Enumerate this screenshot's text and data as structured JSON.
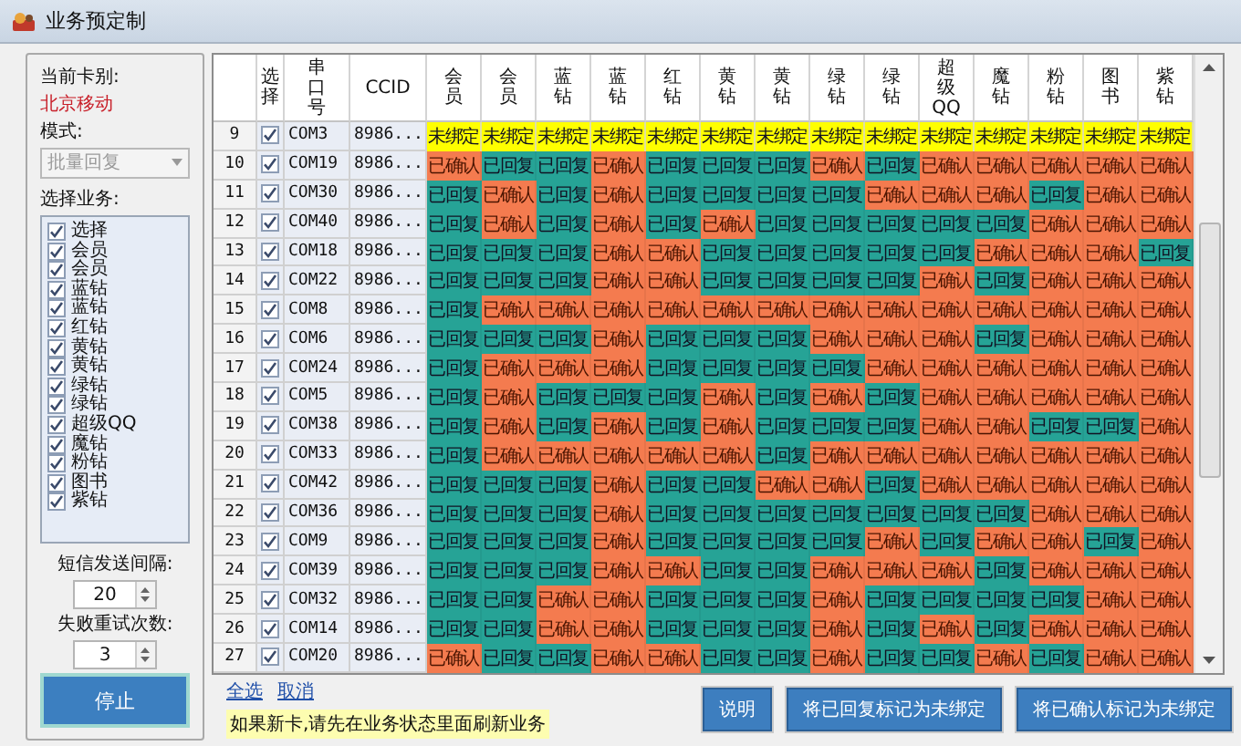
{
  "window": {
    "title": "业务预定制"
  },
  "sidebar": {
    "card_type_label": "当前卡别:",
    "card_type": "北京移动",
    "mode_label": "模式:",
    "mode": {
      "value": "批量回复",
      "disabled": true
    },
    "services_label": "选择业务:",
    "services": [
      {
        "label": "选择",
        "checked": true
      },
      {
        "label": "会员",
        "checked": true
      },
      {
        "label": "会员",
        "checked": true
      },
      {
        "label": "蓝钻",
        "checked": true
      },
      {
        "label": "蓝钻",
        "checked": true
      },
      {
        "label": "红钻",
        "checked": true
      },
      {
        "label": "黄钻",
        "checked": true
      },
      {
        "label": "黄钻",
        "checked": true
      },
      {
        "label": "绿钻",
        "checked": true
      },
      {
        "label": "绿钻",
        "checked": true
      },
      {
        "label": "超级QQ",
        "checked": true
      },
      {
        "label": "魔钻",
        "checked": true
      },
      {
        "label": "粉钻",
        "checked": true
      },
      {
        "label": "图书",
        "checked": true
      },
      {
        "label": "紫钻",
        "checked": true
      }
    ],
    "interval_label": "短信发送间隔:",
    "interval": "20",
    "retries_label": "失败重试次数:",
    "retries": "3",
    "stop_button": "停止"
  },
  "table": {
    "fixed_columns": [
      {
        "label": "选择",
        "kind": "vertical"
      },
      {
        "label": "串口号",
        "kind": "vertical"
      },
      {
        "label": "CCID",
        "kind": "horizontal"
      }
    ],
    "service_columns": [
      {
        "label": "会员",
        "kind": "vertical"
      },
      {
        "label": "会员",
        "kind": "vertical"
      },
      {
        "label": "蓝钻",
        "kind": "vertical"
      },
      {
        "label": "蓝钻",
        "kind": "vertical"
      },
      {
        "label": "红钻",
        "kind": "vertical"
      },
      {
        "label": "黄钻",
        "kind": "vertical"
      },
      {
        "label": "黄钻",
        "kind": "vertical"
      },
      {
        "label": "绿钻",
        "kind": "vertical"
      },
      {
        "label": "绿钻",
        "kind": "vertical"
      },
      {
        "label": "超级QQ",
        "kind": "vertical"
      },
      {
        "label": "魔钻",
        "kind": "vertical"
      },
      {
        "label": "粉钻",
        "kind": "vertical"
      },
      {
        "label": "图书",
        "kind": "vertical"
      },
      {
        "label": "紫钻",
        "kind": "vertical"
      }
    ],
    "rows": [
      {
        "number": "9",
        "checked": true,
        "port": "COM3",
        "ccid": "8986...",
        "cells": [
          {
            "text": "未绑定",
            "kind": "unbound"
          },
          {
            "text": "未绑定",
            "kind": "unbound"
          },
          {
            "text": "未绑定",
            "kind": "unbound"
          },
          {
            "text": "未绑定",
            "kind": "unbound"
          },
          {
            "text": "未绑定",
            "kind": "unbound"
          },
          {
            "text": "未绑定",
            "kind": "unbound"
          },
          {
            "text": "未绑定",
            "kind": "unbound"
          },
          {
            "text": "未绑定",
            "kind": "unbound"
          },
          {
            "text": "未绑定",
            "kind": "unbound"
          },
          {
            "text": "未绑定",
            "kind": "unbound"
          },
          {
            "text": "未绑定",
            "kind": "unbound"
          },
          {
            "text": "未绑定",
            "kind": "unbound"
          },
          {
            "text": "未绑定",
            "kind": "unbound"
          },
          {
            "text": "未绑定",
            "kind": "unbound"
          }
        ]
      },
      {
        "number": "10",
        "checked": true,
        "port": "COM19",
        "ccid": "8986...",
        "cells": [
          {
            "text": "已确认",
            "kind": "confirmed"
          },
          {
            "text": "已回复",
            "kind": "replied"
          },
          {
            "text": "已回复",
            "kind": "replied"
          },
          {
            "text": "已确认",
            "kind": "confirmed"
          },
          {
            "text": "已回复",
            "kind": "replied"
          },
          {
            "text": "已回复",
            "kind": "replied"
          },
          {
            "text": "已回复",
            "kind": "replied"
          },
          {
            "text": "已确认",
            "kind": "confirmed"
          },
          {
            "text": "已回复",
            "kind": "replied"
          },
          {
            "text": "已确认",
            "kind": "confirmed"
          },
          {
            "text": "已确认",
            "kind": "confirmed"
          },
          {
            "text": "已确认",
            "kind": "confirmed"
          },
          {
            "text": "已确认",
            "kind": "confirmed"
          },
          {
            "text": "已确认",
            "kind": "confirmed"
          }
        ]
      },
      {
        "number": "11",
        "checked": true,
        "port": "COM30",
        "ccid": "8986...",
        "cells": [
          {
            "text": "已回复",
            "kind": "replied"
          },
          {
            "text": "已确认",
            "kind": "confirmed"
          },
          {
            "text": "已回复",
            "kind": "replied"
          },
          {
            "text": "已确认",
            "kind": "confirmed"
          },
          {
            "text": "已回复",
            "kind": "replied"
          },
          {
            "text": "已回复",
            "kind": "replied"
          },
          {
            "text": "已回复",
            "kind": "replied"
          },
          {
            "text": "已回复",
            "kind": "replied"
          },
          {
            "text": "已确认",
            "kind": "confirmed"
          },
          {
            "text": "已确认",
            "kind": "confirmed"
          },
          {
            "text": "已确认",
            "kind": "confirmed"
          },
          {
            "text": "已回复",
            "kind": "replied"
          },
          {
            "text": "已确认",
            "kind": "confirmed"
          },
          {
            "text": "已确认",
            "kind": "confirmed"
          }
        ]
      },
      {
        "number": "12",
        "checked": true,
        "port": "COM40",
        "ccid": "8986...",
        "cells": [
          {
            "text": "已回复",
            "kind": "replied"
          },
          {
            "text": "已确认",
            "kind": "confirmed"
          },
          {
            "text": "已回复",
            "kind": "replied"
          },
          {
            "text": "已确认",
            "kind": "confirmed"
          },
          {
            "text": "已回复",
            "kind": "replied"
          },
          {
            "text": "已确认",
            "kind": "confirmed"
          },
          {
            "text": "已回复",
            "kind": "replied"
          },
          {
            "text": "已回复",
            "kind": "replied"
          },
          {
            "text": "已回复",
            "kind": "replied"
          },
          {
            "text": "已回复",
            "kind": "replied"
          },
          {
            "text": "已回复",
            "kind": "replied"
          },
          {
            "text": "已确认",
            "kind": "confirmed"
          },
          {
            "text": "已确认",
            "kind": "confirmed"
          },
          {
            "text": "已确认",
            "kind": "confirmed"
          }
        ]
      },
      {
        "number": "13",
        "checked": true,
        "port": "COM18",
        "ccid": "8986...",
        "cells": [
          {
            "text": "已回复",
            "kind": "replied"
          },
          {
            "text": "已回复",
            "kind": "replied"
          },
          {
            "text": "已回复",
            "kind": "replied"
          },
          {
            "text": "已确认",
            "kind": "confirmed"
          },
          {
            "text": "已确认",
            "kind": "confirmed"
          },
          {
            "text": "已回复",
            "kind": "replied"
          },
          {
            "text": "已回复",
            "kind": "replied"
          },
          {
            "text": "已回复",
            "kind": "replied"
          },
          {
            "text": "已回复",
            "kind": "replied"
          },
          {
            "text": "已回复",
            "kind": "replied"
          },
          {
            "text": "已确认",
            "kind": "confirmed"
          },
          {
            "text": "已确认",
            "kind": "confirmed"
          },
          {
            "text": "已确认",
            "kind": "confirmed"
          },
          {
            "text": "已回复",
            "kind": "replied"
          }
        ]
      },
      {
        "number": "14",
        "checked": true,
        "port": "COM22",
        "ccid": "8986...",
        "cells": [
          {
            "text": "已回复",
            "kind": "replied"
          },
          {
            "text": "已回复",
            "kind": "replied"
          },
          {
            "text": "已回复",
            "kind": "replied"
          },
          {
            "text": "已确认",
            "kind": "confirmed"
          },
          {
            "text": "已确认",
            "kind": "confirmed"
          },
          {
            "text": "已回复",
            "kind": "replied"
          },
          {
            "text": "已回复",
            "kind": "replied"
          },
          {
            "text": "已回复",
            "kind": "replied"
          },
          {
            "text": "已回复",
            "kind": "replied"
          },
          {
            "text": "已确认",
            "kind": "confirmed"
          },
          {
            "text": "已回复",
            "kind": "replied"
          },
          {
            "text": "已确认",
            "kind": "confirmed"
          },
          {
            "text": "已确认",
            "kind": "confirmed"
          },
          {
            "text": "已确认",
            "kind": "confirmed"
          }
        ]
      },
      {
        "number": "15",
        "checked": true,
        "port": "COM8",
        "ccid": "8986...",
        "cells": [
          {
            "text": "已回复",
            "kind": "replied"
          },
          {
            "text": "已确认",
            "kind": "confirmed"
          },
          {
            "text": "已确认",
            "kind": "confirmed"
          },
          {
            "text": "已确认",
            "kind": "confirmed"
          },
          {
            "text": "已确认",
            "kind": "confirmed"
          },
          {
            "text": "已确认",
            "kind": "confirmed"
          },
          {
            "text": "已确认",
            "kind": "confirmed"
          },
          {
            "text": "已确认",
            "kind": "confirmed"
          },
          {
            "text": "已确认",
            "kind": "confirmed"
          },
          {
            "text": "已确认",
            "kind": "confirmed"
          },
          {
            "text": "已确认",
            "kind": "confirmed"
          },
          {
            "text": "已确认",
            "kind": "confirmed"
          },
          {
            "text": "已确认",
            "kind": "confirmed"
          },
          {
            "text": "已确认",
            "kind": "confirmed"
          }
        ]
      },
      {
        "number": "16",
        "checked": true,
        "port": "COM6",
        "ccid": "8986...",
        "cells": [
          {
            "text": "已回复",
            "kind": "replied"
          },
          {
            "text": "已回复",
            "kind": "replied"
          },
          {
            "text": "已回复",
            "kind": "replied"
          },
          {
            "text": "已确认",
            "kind": "confirmed"
          },
          {
            "text": "已回复",
            "kind": "replied"
          },
          {
            "text": "已回复",
            "kind": "replied"
          },
          {
            "text": "已回复",
            "kind": "replied"
          },
          {
            "text": "已确认",
            "kind": "confirmed"
          },
          {
            "text": "已确认",
            "kind": "confirmed"
          },
          {
            "text": "已确认",
            "kind": "confirmed"
          },
          {
            "text": "已回复",
            "kind": "replied"
          },
          {
            "text": "已确认",
            "kind": "confirmed"
          },
          {
            "text": "已确认",
            "kind": "confirmed"
          },
          {
            "text": "已确认",
            "kind": "confirmed"
          }
        ]
      },
      {
        "number": "17",
        "checked": true,
        "port": "COM24",
        "ccid": "8986...",
        "cells": [
          {
            "text": "已回复",
            "kind": "replied"
          },
          {
            "text": "已确认",
            "kind": "confirmed"
          },
          {
            "text": "已确认",
            "kind": "confirmed"
          },
          {
            "text": "已确认",
            "kind": "confirmed"
          },
          {
            "text": "已回复",
            "kind": "replied"
          },
          {
            "text": "已回复",
            "kind": "replied"
          },
          {
            "text": "已回复",
            "kind": "replied"
          },
          {
            "text": "已回复",
            "kind": "replied"
          },
          {
            "text": "已确认",
            "kind": "confirmed"
          },
          {
            "text": "已确认",
            "kind": "confirmed"
          },
          {
            "text": "已确认",
            "kind": "confirmed"
          },
          {
            "text": "已确认",
            "kind": "confirmed"
          },
          {
            "text": "已确认",
            "kind": "confirmed"
          },
          {
            "text": "已确认",
            "kind": "confirmed"
          }
        ]
      },
      {
        "number": "18",
        "checked": true,
        "port": "COM5",
        "ccid": "8986...",
        "cells": [
          {
            "text": "已回复",
            "kind": "replied"
          },
          {
            "text": "已确认",
            "kind": "confirmed"
          },
          {
            "text": "已回复",
            "kind": "replied"
          },
          {
            "text": "已回复",
            "kind": "replied"
          },
          {
            "text": "已回复",
            "kind": "replied"
          },
          {
            "text": "已确认",
            "kind": "confirmed"
          },
          {
            "text": "已回复",
            "kind": "replied"
          },
          {
            "text": "已确认",
            "kind": "confirmed"
          },
          {
            "text": "已回复",
            "kind": "replied"
          },
          {
            "text": "已确认",
            "kind": "confirmed"
          },
          {
            "text": "已确认",
            "kind": "confirmed"
          },
          {
            "text": "已确认",
            "kind": "confirmed"
          },
          {
            "text": "已确认",
            "kind": "confirmed"
          },
          {
            "text": "已确认",
            "kind": "confirmed"
          }
        ]
      },
      {
        "number": "19",
        "checked": true,
        "port": "COM38",
        "ccid": "8986...",
        "cells": [
          {
            "text": "已回复",
            "kind": "replied"
          },
          {
            "text": "已确认",
            "kind": "confirmed"
          },
          {
            "text": "已回复",
            "kind": "replied"
          },
          {
            "text": "已确认",
            "kind": "confirmed"
          },
          {
            "text": "已回复",
            "kind": "replied"
          },
          {
            "text": "已确认",
            "kind": "confirmed"
          },
          {
            "text": "已回复",
            "kind": "replied"
          },
          {
            "text": "已回复",
            "kind": "replied"
          },
          {
            "text": "已回复",
            "kind": "replied"
          },
          {
            "text": "已确认",
            "kind": "confirmed"
          },
          {
            "text": "已确认",
            "kind": "confirmed"
          },
          {
            "text": "已回复",
            "kind": "replied"
          },
          {
            "text": "已回复",
            "kind": "replied"
          },
          {
            "text": "已确认",
            "kind": "confirmed"
          }
        ]
      },
      {
        "number": "20",
        "checked": true,
        "port": "COM33",
        "ccid": "8986...",
        "cells": [
          {
            "text": "已回复",
            "kind": "replied"
          },
          {
            "text": "已确认",
            "kind": "confirmed"
          },
          {
            "text": "已确认",
            "kind": "confirmed"
          },
          {
            "text": "已确认",
            "kind": "confirmed"
          },
          {
            "text": "已确认",
            "kind": "confirmed"
          },
          {
            "text": "已确认",
            "kind": "confirmed"
          },
          {
            "text": "已回复",
            "kind": "replied"
          },
          {
            "text": "已确认",
            "kind": "confirmed"
          },
          {
            "text": "已确认",
            "kind": "confirmed"
          },
          {
            "text": "已确认",
            "kind": "confirmed"
          },
          {
            "text": "已确认",
            "kind": "confirmed"
          },
          {
            "text": "已确认",
            "kind": "confirmed"
          },
          {
            "text": "已确认",
            "kind": "confirmed"
          },
          {
            "text": "已确认",
            "kind": "confirmed"
          }
        ]
      },
      {
        "number": "21",
        "checked": true,
        "port": "COM42",
        "ccid": "8986...",
        "cells": [
          {
            "text": "已回复",
            "kind": "replied"
          },
          {
            "text": "已回复",
            "kind": "replied"
          },
          {
            "text": "已回复",
            "kind": "replied"
          },
          {
            "text": "已确认",
            "kind": "confirmed"
          },
          {
            "text": "已回复",
            "kind": "replied"
          },
          {
            "text": "已回复",
            "kind": "replied"
          },
          {
            "text": "已确认",
            "kind": "confirmed"
          },
          {
            "text": "已确认",
            "kind": "confirmed"
          },
          {
            "text": "已回复",
            "kind": "replied"
          },
          {
            "text": "已确认",
            "kind": "confirmed"
          },
          {
            "text": "已确认",
            "kind": "confirmed"
          },
          {
            "text": "已确认",
            "kind": "confirmed"
          },
          {
            "text": "已确认",
            "kind": "confirmed"
          },
          {
            "text": "已确认",
            "kind": "confirmed"
          }
        ]
      },
      {
        "number": "22",
        "checked": true,
        "port": "COM36",
        "ccid": "8986...",
        "cells": [
          {
            "text": "已回复",
            "kind": "replied"
          },
          {
            "text": "已回复",
            "kind": "replied"
          },
          {
            "text": "已回复",
            "kind": "replied"
          },
          {
            "text": "已确认",
            "kind": "confirmed"
          },
          {
            "text": "已回复",
            "kind": "replied"
          },
          {
            "text": "已回复",
            "kind": "replied"
          },
          {
            "text": "已回复",
            "kind": "replied"
          },
          {
            "text": "已回复",
            "kind": "replied"
          },
          {
            "text": "已回复",
            "kind": "replied"
          },
          {
            "text": "已回复",
            "kind": "replied"
          },
          {
            "text": "已回复",
            "kind": "replied"
          },
          {
            "text": "已确认",
            "kind": "confirmed"
          },
          {
            "text": "已确认",
            "kind": "confirmed"
          },
          {
            "text": "已确认",
            "kind": "confirmed"
          }
        ]
      },
      {
        "number": "23",
        "checked": true,
        "port": "COM9",
        "ccid": "8986...",
        "cells": [
          {
            "text": "已回复",
            "kind": "replied"
          },
          {
            "text": "已回复",
            "kind": "replied"
          },
          {
            "text": "已回复",
            "kind": "replied"
          },
          {
            "text": "已确认",
            "kind": "confirmed"
          },
          {
            "text": "已回复",
            "kind": "replied"
          },
          {
            "text": "已回复",
            "kind": "replied"
          },
          {
            "text": "已回复",
            "kind": "replied"
          },
          {
            "text": "已回复",
            "kind": "replied"
          },
          {
            "text": "已确认",
            "kind": "confirmed"
          },
          {
            "text": "已回复",
            "kind": "replied"
          },
          {
            "text": "已确认",
            "kind": "confirmed"
          },
          {
            "text": "已确认",
            "kind": "confirmed"
          },
          {
            "text": "已回复",
            "kind": "replied"
          },
          {
            "text": "已确认",
            "kind": "confirmed"
          }
        ]
      },
      {
        "number": "24",
        "checked": true,
        "port": "COM39",
        "ccid": "8986...",
        "cells": [
          {
            "text": "已回复",
            "kind": "replied"
          },
          {
            "text": "已回复",
            "kind": "replied"
          },
          {
            "text": "已回复",
            "kind": "replied"
          },
          {
            "text": "已确认",
            "kind": "confirmed"
          },
          {
            "text": "已确认",
            "kind": "confirmed"
          },
          {
            "text": "已回复",
            "kind": "replied"
          },
          {
            "text": "已回复",
            "kind": "replied"
          },
          {
            "text": "已确认",
            "kind": "confirmed"
          },
          {
            "text": "已确认",
            "kind": "confirmed"
          },
          {
            "text": "已确认",
            "kind": "confirmed"
          },
          {
            "text": "已回复",
            "kind": "replied"
          },
          {
            "text": "已确认",
            "kind": "confirmed"
          },
          {
            "text": "已确认",
            "kind": "confirmed"
          },
          {
            "text": "已确认",
            "kind": "confirmed"
          }
        ]
      },
      {
        "number": "25",
        "checked": true,
        "port": "COM32",
        "ccid": "8986...",
        "cells": [
          {
            "text": "已回复",
            "kind": "replied"
          },
          {
            "text": "已回复",
            "kind": "replied"
          },
          {
            "text": "已确认",
            "kind": "confirmed"
          },
          {
            "text": "已确认",
            "kind": "confirmed"
          },
          {
            "text": "已回复",
            "kind": "replied"
          },
          {
            "text": "已回复",
            "kind": "replied"
          },
          {
            "text": "已回复",
            "kind": "replied"
          },
          {
            "text": "已确认",
            "kind": "confirmed"
          },
          {
            "text": "已回复",
            "kind": "replied"
          },
          {
            "text": "已回复",
            "kind": "replied"
          },
          {
            "text": "已回复",
            "kind": "replied"
          },
          {
            "text": "已回复",
            "kind": "replied"
          },
          {
            "text": "已确认",
            "kind": "confirmed"
          },
          {
            "text": "已确认",
            "kind": "confirmed"
          }
        ]
      },
      {
        "number": "26",
        "checked": true,
        "port": "COM14",
        "ccid": "8986...",
        "cells": [
          {
            "text": "已回复",
            "kind": "replied"
          },
          {
            "text": "已回复",
            "kind": "replied"
          },
          {
            "text": "已确认",
            "kind": "confirmed"
          },
          {
            "text": "已确认",
            "kind": "confirmed"
          },
          {
            "text": "已回复",
            "kind": "replied"
          },
          {
            "text": "已回复",
            "kind": "replied"
          },
          {
            "text": "已回复",
            "kind": "replied"
          },
          {
            "text": "已确认",
            "kind": "confirmed"
          },
          {
            "text": "已回复",
            "kind": "replied"
          },
          {
            "text": "已确认",
            "kind": "confirmed"
          },
          {
            "text": "已回复",
            "kind": "replied"
          },
          {
            "text": "已确认",
            "kind": "confirmed"
          },
          {
            "text": "已确认",
            "kind": "confirmed"
          },
          {
            "text": "已确认",
            "kind": "confirmed"
          }
        ]
      },
      {
        "number": "27",
        "checked": true,
        "port": "COM20",
        "ccid": "8986...",
        "cells": [
          {
            "text": "已确认",
            "kind": "confirmed"
          },
          {
            "text": "已回复",
            "kind": "replied"
          },
          {
            "text": "已回复",
            "kind": "replied"
          },
          {
            "text": "已确认",
            "kind": "confirmed"
          },
          {
            "text": "已确认",
            "kind": "confirmed"
          },
          {
            "text": "已回复",
            "kind": "replied"
          },
          {
            "text": "已回复",
            "kind": "replied"
          },
          {
            "text": "已确认",
            "kind": "confirmed"
          },
          {
            "text": "已回复",
            "kind": "replied"
          },
          {
            "text": "已回复",
            "kind": "replied"
          },
          {
            "text": "已确认",
            "kind": "confirmed"
          },
          {
            "text": "已回复",
            "kind": "replied"
          },
          {
            "text": "已确认",
            "kind": "confirmed"
          },
          {
            "text": "已确认",
            "kind": "confirmed"
          }
        ]
      }
    ]
  },
  "footer": {
    "links": [
      "全选",
      "取消"
    ],
    "note": "如果新卡,请先在业务状态里面刷新业务",
    "buttons": [
      "说明",
      "将已回复标记为未绑定",
      "将已确认标记为未绑定"
    ]
  }
}
